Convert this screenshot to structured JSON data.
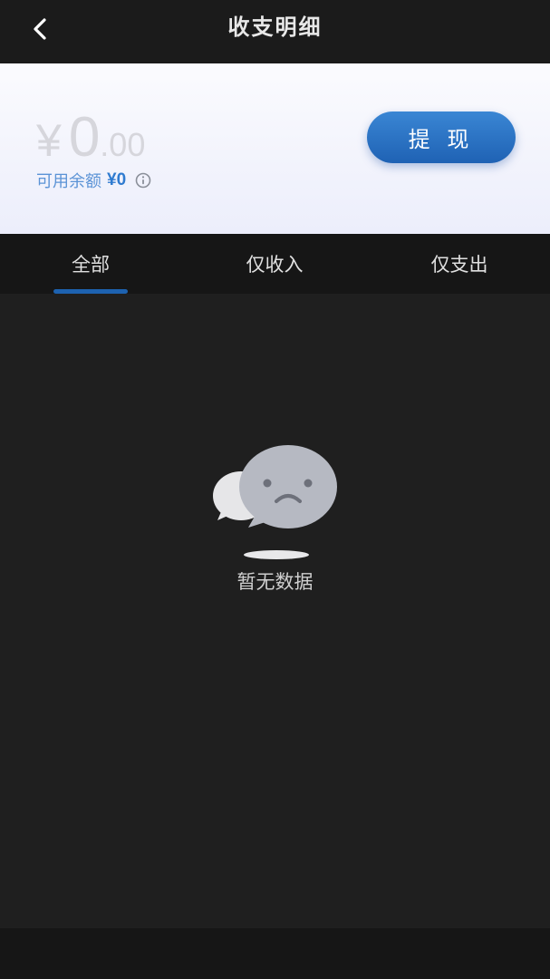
{
  "header": {
    "title": "收支明细"
  },
  "balance": {
    "currency_symbol": "¥",
    "amount_int": "0",
    "amount_dec": ".00",
    "available_label": "可用余额",
    "available_value": "¥0",
    "withdraw_label": "提 现"
  },
  "tabs": [
    {
      "label": "全部",
      "selected": true
    },
    {
      "label": "仅收入",
      "selected": false
    },
    {
      "label": "仅支出",
      "selected": false
    }
  ],
  "empty_state": {
    "message": "暂无数据",
    "icon": "sad-chat-bubble-icon"
  },
  "colors": {
    "accent": "#1d62b0",
    "button_gradient_top": "#3a86d4",
    "button_gradient_bottom": "#1f62b4",
    "background": "#1f1f1f",
    "available_text": "#5b93d6"
  }
}
